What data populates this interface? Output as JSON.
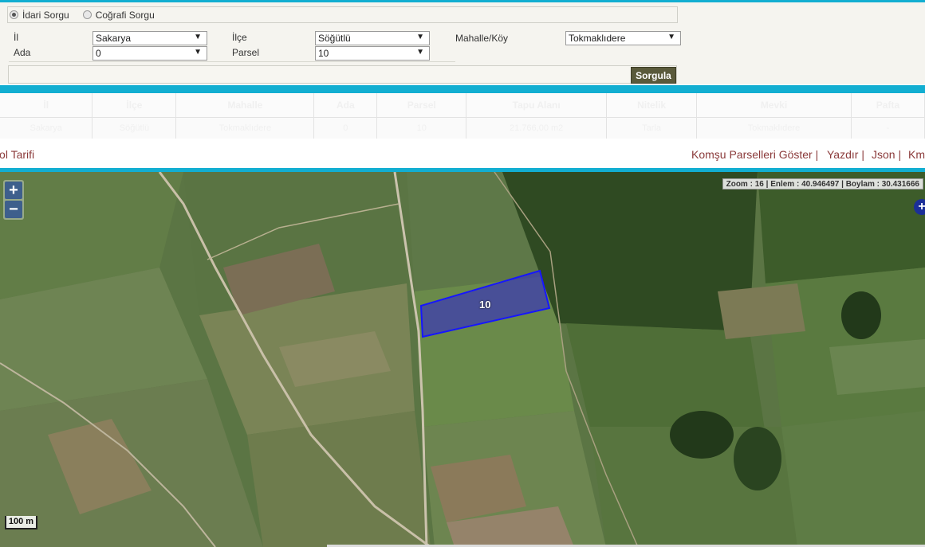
{
  "query_mode": {
    "options": [
      {
        "label": "İdari Sorgu",
        "selected": true
      },
      {
        "label": "Coğrafi Sorgu",
        "selected": false
      }
    ]
  },
  "form": {
    "il_label": "İl",
    "il_value": "Sakarya",
    "ilce_label": "İlçe",
    "ilce_value": "Söğütlü",
    "mahalle_label": "Mahalle/Köy",
    "mahalle_value": "Tokmaklıdere",
    "ada_label": "Ada",
    "ada_value": "0",
    "parsel_label": "Parsel",
    "parsel_value": "10",
    "search_button": "Sorgula"
  },
  "results": {
    "headers": [
      "İl",
      "İlçe",
      "Mahalle",
      "Ada",
      "Parsel",
      "Tapu Alanı",
      "Nitelik",
      "Mevki",
      "Pafta"
    ],
    "rows": [
      [
        "Sakarya",
        "Söğütlü",
        "Tokmaklıdere",
        "0",
        "10",
        "21.766,00 m2",
        "Tarla",
        "Tokmaklıdere",
        "-"
      ]
    ]
  },
  "links": {
    "directions": "Yol Tarifi",
    "neighbors": "Komşu Parselleri Göster |",
    "print": "Yazdır |",
    "json": "Json |",
    "kml": "Kml"
  },
  "map": {
    "zoom_in": "+",
    "zoom_out": "−",
    "coords_text": "Zoom : 16 | Enlem : 40.946497 | Boylam : 30.431666",
    "parcel_label": "10",
    "scale_label": "100 m",
    "layer_button": "+",
    "colors": {
      "parcel_fill": "#3a36b8",
      "parcel_stroke": "#1616ff",
      "accent": "#12aed1"
    }
  }
}
